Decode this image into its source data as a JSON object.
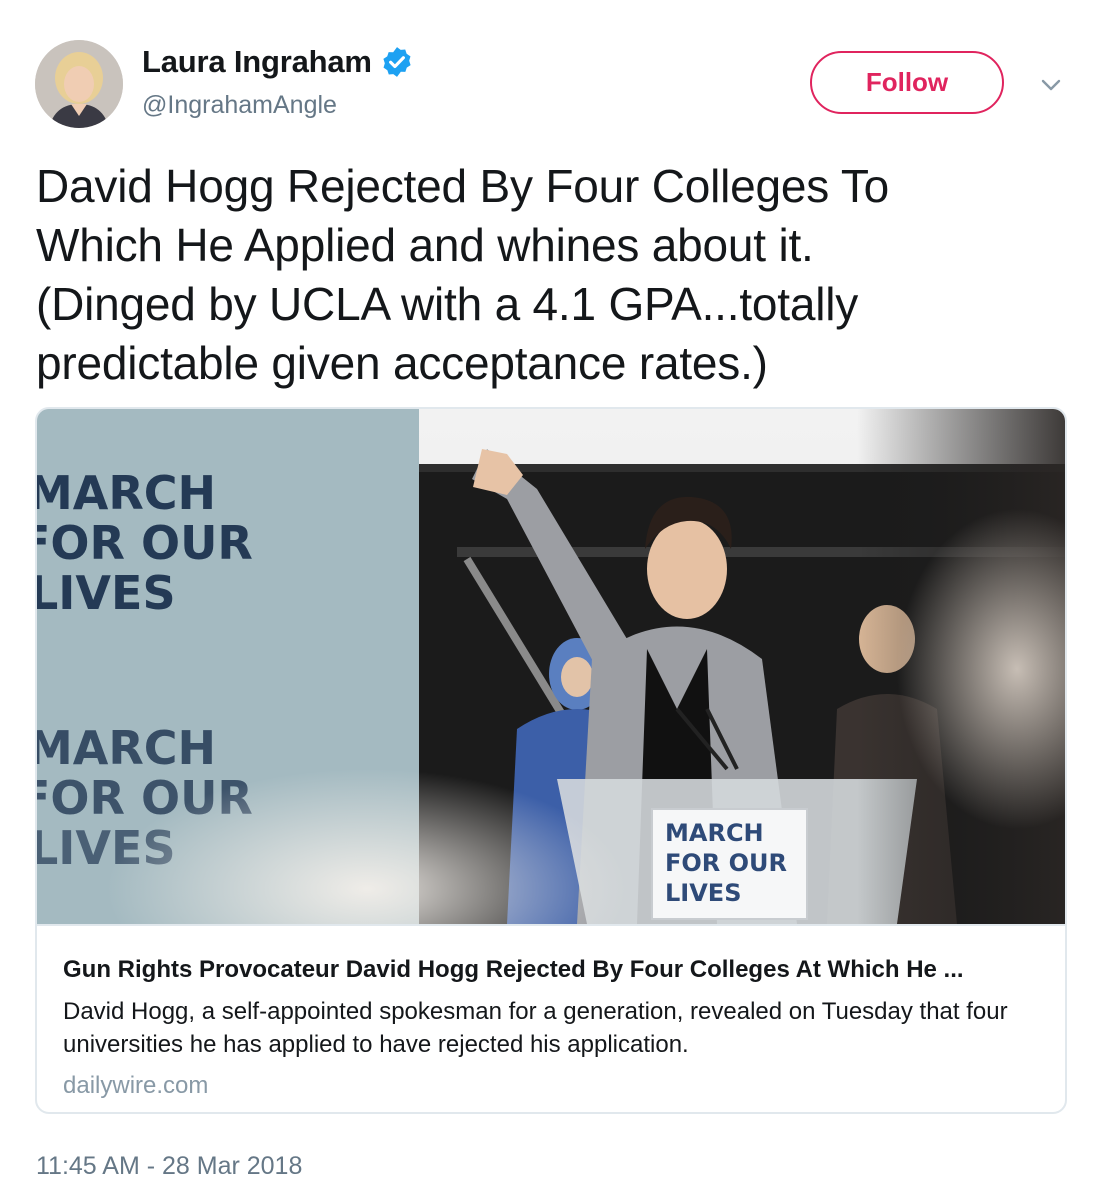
{
  "author": {
    "display_name": "Laura Ingraham",
    "handle": "@IngrahamAngle",
    "verified": true
  },
  "actions": {
    "follow_label": "Follow",
    "follow_color": "#e0245e",
    "more_icon": "chevron-down-icon"
  },
  "tweet": {
    "text": "David Hogg Rejected By Four Colleges To\nWhich He Applied and whines about it.\n(Dinged by UCLA with a 4.1 GPA...totally\npredictable given acceptance rates.)",
    "timestamp": "11:45 AM - 28 Mar 2018"
  },
  "card": {
    "title": "Gun Rights Provocateur David Hogg Rejected By Four Colleges At Which He ...",
    "description": "David Hogg, a self-appointed spokesman for a generation, revealed on Tuesday that four universities he has applied to have rejected his application.",
    "domain": "dailywire.com",
    "image_sign_text": {
      "line1": "MARCH",
      "line2": "FOR OUR",
      "line3": "LIVES"
    }
  },
  "colors": {
    "verified_blue": "#1da1f2",
    "secondary_text": "#657786",
    "card_border": "#e1e8ed"
  }
}
